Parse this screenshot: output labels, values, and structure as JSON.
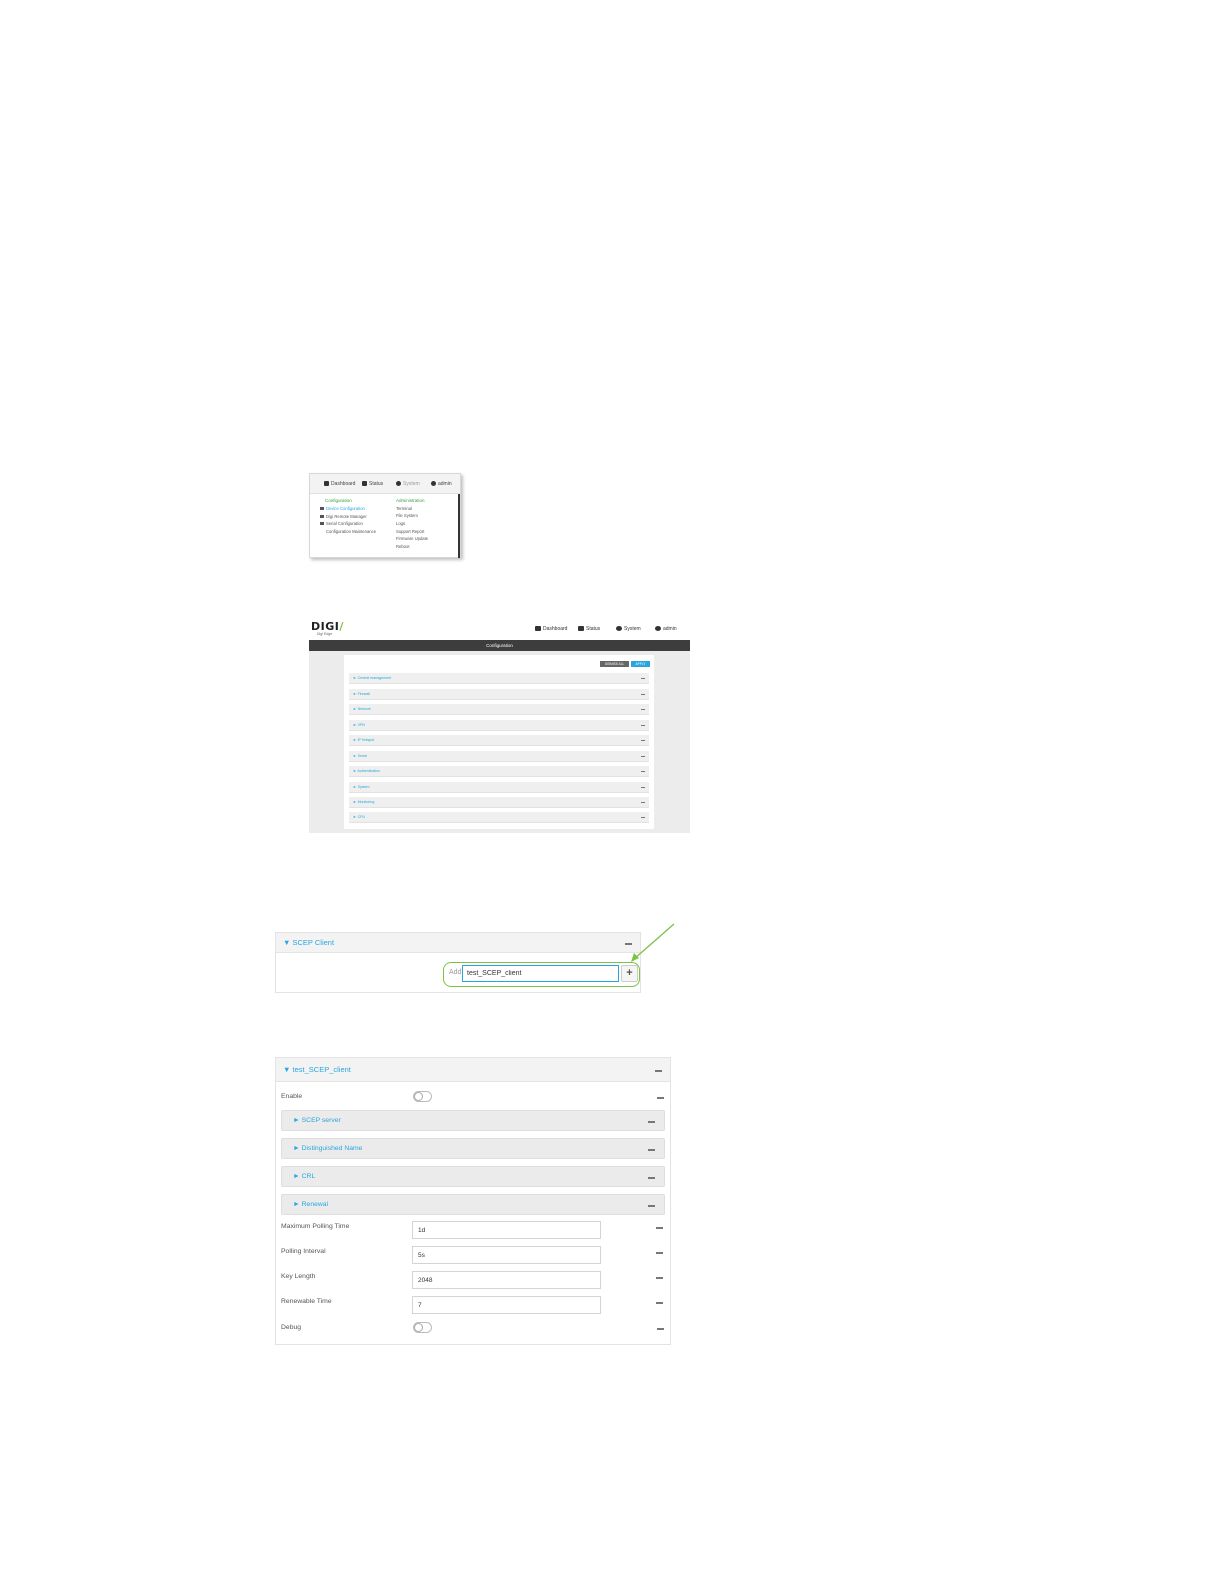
{
  "menu_screenshot": {
    "topbar": {
      "dashboard": "Dashboard",
      "status": "Status",
      "system": "System",
      "admin": "admin"
    },
    "configuration": {
      "heading": "Configuration",
      "items": [
        "Device Configuration",
        "Digi Remote Manager",
        "Serial Configuration",
        "Configuration Maintenance"
      ]
    },
    "administration": {
      "heading": "Administration",
      "items": [
        "Terminal",
        "File System",
        "Logs",
        "Support Report",
        "Firmware Update",
        "Reboot"
      ]
    }
  },
  "config_screenshot": {
    "logo": "DIGI",
    "logo_sub": "Digi Edge",
    "nav": {
      "dashboard": "Dashboard",
      "status": "Status",
      "system": "System",
      "admin": "admin"
    },
    "title": "Configuration",
    "buttons": {
      "dismiss": "DISMISS ALL",
      "apply": "APPLY"
    },
    "sections": [
      "Central management",
      "Firewall",
      "Network",
      "VPN",
      "IP Hotspot",
      "Serial",
      "Authentication",
      "System",
      "Monitoring",
      "CPU"
    ]
  },
  "scep_add_screenshot": {
    "header": "SCEP Client",
    "add_label": "Add",
    "input_value": "test_SCEP_client",
    "plus": "+"
  },
  "scep_client_screenshot": {
    "header": "test_SCEP_client",
    "enable_label": "Enable",
    "enable_on": false,
    "subsections": [
      "SCEP server",
      "Distinguished Name",
      "CRL",
      "Renewal"
    ],
    "fields": [
      {
        "label": "Maximum Polling Time",
        "value": "1d"
      },
      {
        "label": "Polling Interval",
        "value": "5s"
      },
      {
        "label": "Key Length",
        "value": "2048"
      },
      {
        "label": "Renewable Time",
        "value": "7"
      }
    ],
    "debug_label": "Debug",
    "debug_on": false,
    "colors": {
      "link_blue": "#28a6de",
      "highlight_green": "#7cc243"
    }
  }
}
